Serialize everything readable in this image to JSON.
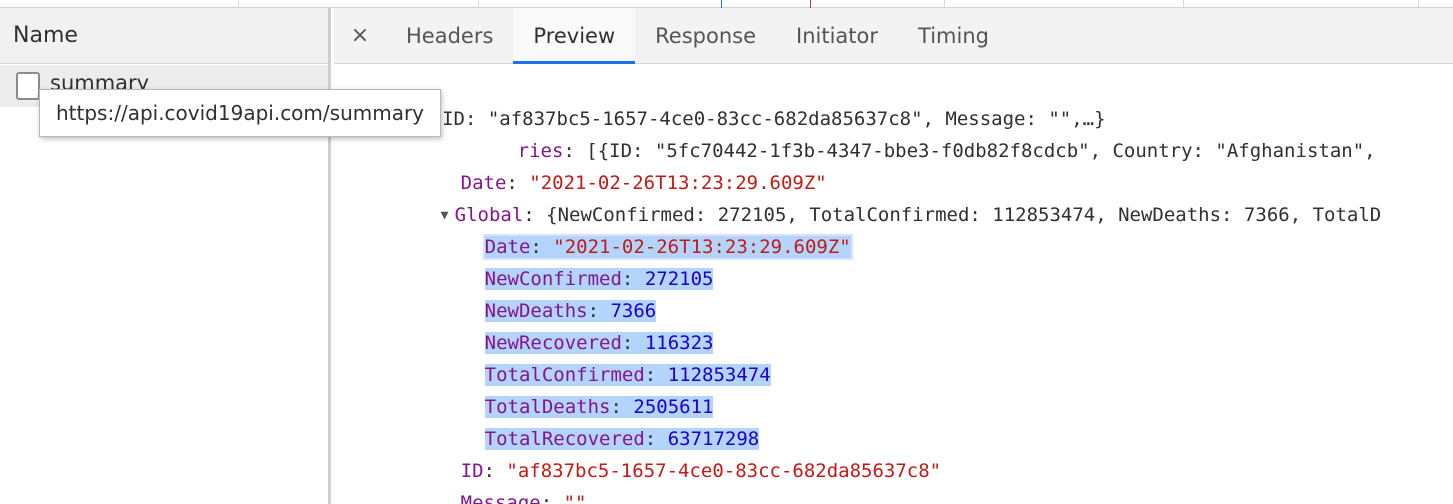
{
  "left_panel": {
    "column_header": "Name",
    "request_name": "summary",
    "tooltip_url": "https://api.covid19api.com/summary"
  },
  "tabs": {
    "close_glyph": "×",
    "items": [
      "Headers",
      "Preview",
      "Response",
      "Initiator",
      "Timing"
    ],
    "active": "Preview"
  },
  "preview": {
    "root_summary": "{ID: \"af837bc5-1657-4ce0-83cc-682da85637c8\", Message: \"\",…}",
    "countries_key": "ries",
    "countries_summary": ": [{ID: \"5fc70442-1f3b-4347-bbe3-f0db82f8cdcb\", Country: \"Afghanistan\",",
    "date_key": "Date",
    "date_value": "\"2021-02-26T13:23:29.609Z\"",
    "global_key": "Global",
    "global_summary": ": {NewConfirmed: 272105, TotalConfirmed: 112853474, NewDeaths: 7366, TotalD",
    "global_fields": [
      {
        "key": "Date",
        "value": "\"2021-02-26T13:23:29.609Z\"",
        "type": "string"
      },
      {
        "key": "NewConfirmed",
        "value": "272105",
        "type": "number"
      },
      {
        "key": "NewDeaths",
        "value": "7366",
        "type": "number"
      },
      {
        "key": "NewRecovered",
        "value": "116323",
        "type": "number"
      },
      {
        "key": "TotalConfirmed",
        "value": "112853474",
        "type": "number"
      },
      {
        "key": "TotalDeaths",
        "value": "2505611",
        "type": "number"
      },
      {
        "key": "TotalRecovered",
        "value": "63717298",
        "type": "number"
      }
    ],
    "id_key": "ID",
    "id_value": "\"af837bc5-1657-4ce0-83cc-682da85637c8\"",
    "message_key": "Message",
    "message_value": "\"\""
  },
  "colors": {
    "key": "#881391",
    "string": "#c41a16",
    "number": "#1c00cf",
    "selection": "#b3d4fc",
    "active_tab_underline": "#1a73e8"
  }
}
